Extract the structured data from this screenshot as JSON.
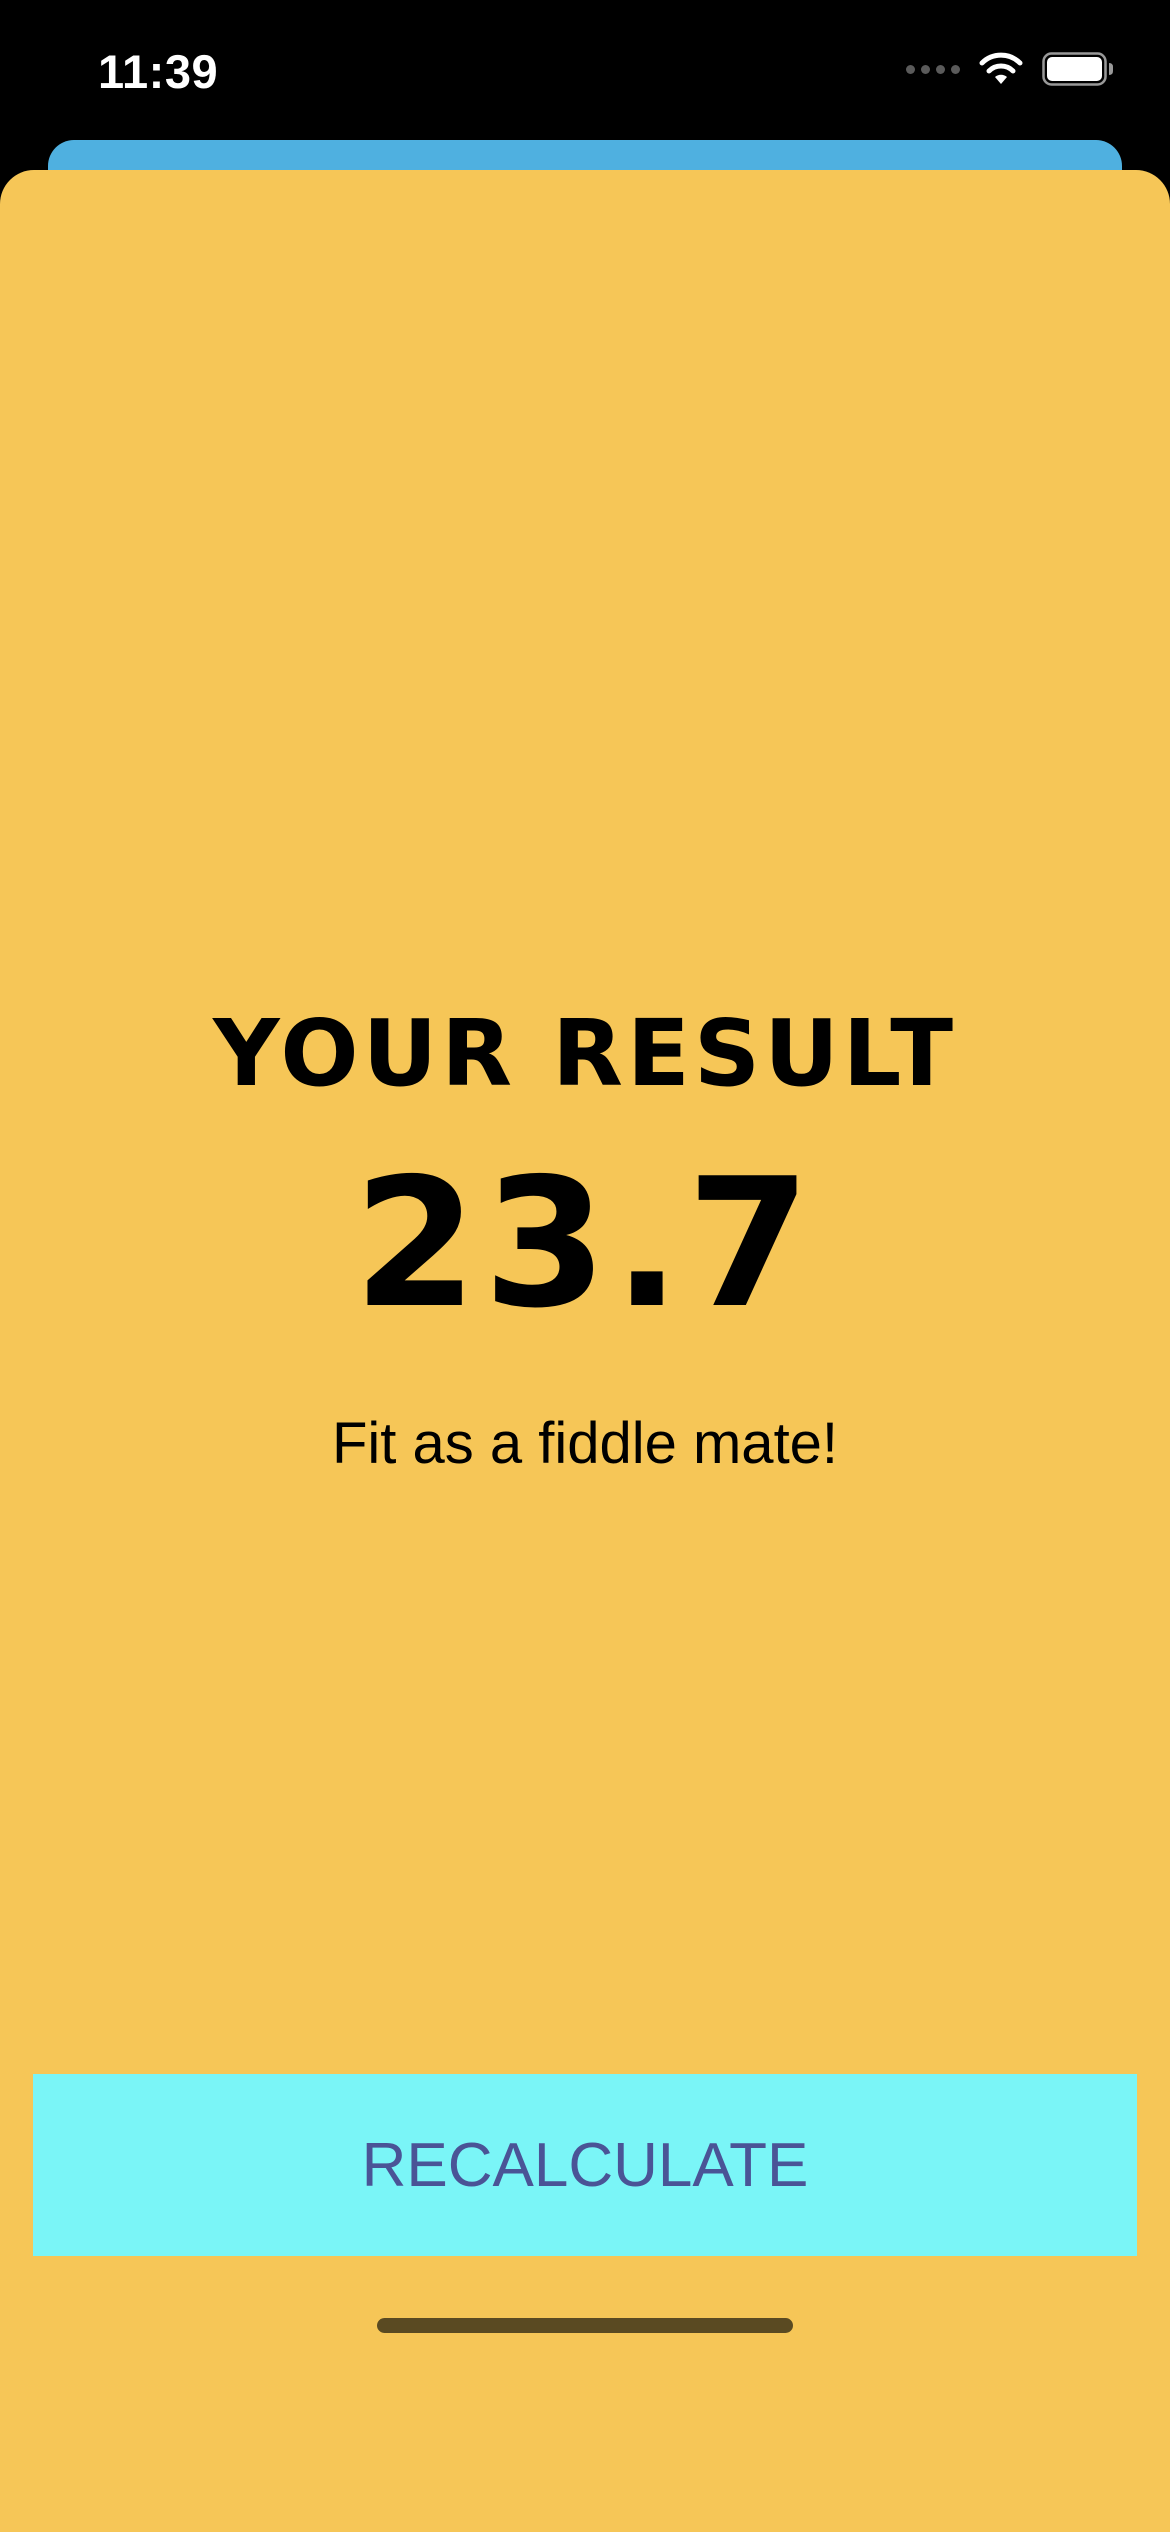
{
  "status_bar": {
    "time": "11:39"
  },
  "result": {
    "title": "YOUR RESULT",
    "value": "23.7",
    "advice": "Fit as a fiddle mate!"
  },
  "actions": {
    "recalculate_label": "RECALCULATE"
  },
  "colors": {
    "sheet_background": "#f6c657",
    "back_sheet": "#4fb0e0",
    "button_background": "#7af5f7",
    "button_text": "#4a5496"
  }
}
